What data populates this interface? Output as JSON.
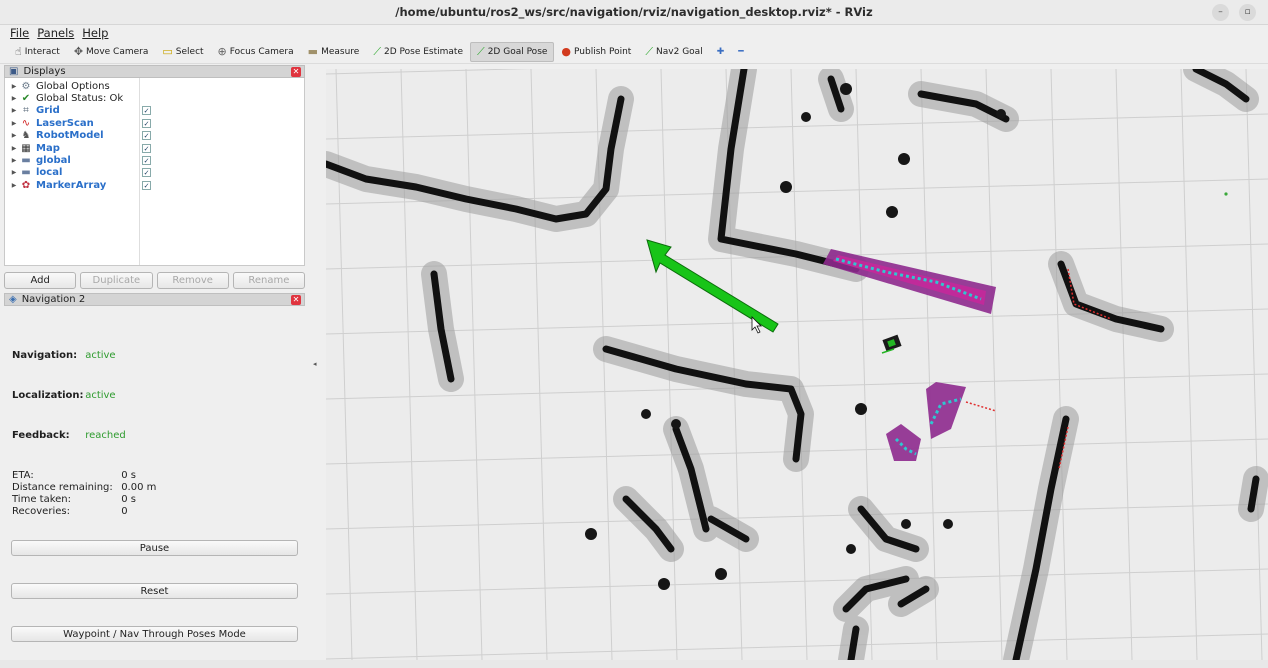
{
  "window": {
    "title": "/home/ubuntu/ros2_ws/src/navigation/rviz/navigation_desktop.rviz* - RViz",
    "minimize_glyph": "–",
    "restore_glyph": "▫"
  },
  "menu": [
    "File",
    "Panels",
    "Help"
  ],
  "toolbar": {
    "tools": [
      {
        "label": "Interact",
        "icon": "hand-icon",
        "glyph": "☝",
        "color": "#444444"
      },
      {
        "label": "Move Camera",
        "icon": "move-icon",
        "glyph": "✥",
        "color": "#555555"
      },
      {
        "label": "Select",
        "icon": "select-icon",
        "glyph": "▭",
        "color": "#c9a400"
      },
      {
        "label": "Focus Camera",
        "icon": "focus-icon",
        "glyph": "⊕",
        "color": "#666666"
      },
      {
        "label": "Measure",
        "icon": "ruler-icon",
        "glyph": "▬",
        "color": "#a0916a"
      },
      {
        "label": "2D Pose Estimate",
        "icon": "pose-arrow-icon",
        "glyph": "⟋",
        "color": "#2eaa2e"
      },
      {
        "label": "2D Goal Pose",
        "icon": "goal-arrow-icon",
        "glyph": "⟋",
        "color": "#2eaa2e",
        "active": true
      },
      {
        "label": "Publish Point",
        "icon": "map-pin-icon",
        "glyph": "●",
        "color": "#d23a1e"
      },
      {
        "label": "Nav2 Goal",
        "icon": "nav2-arrow-icon",
        "glyph": "⟋",
        "color": "#2eaa2e"
      }
    ],
    "add_glyph": "✚",
    "remove_glyph": "━"
  },
  "displays": {
    "title": "Displays",
    "items": [
      {
        "label": "Global Options",
        "icon": "gear-icon",
        "glyph": "⚙",
        "color": "#6a7a8a",
        "checked": null,
        "blue": false
      },
      {
        "label": "Global Status: Ok",
        "icon": "checkmark-icon",
        "glyph": "✔",
        "color": "#2c8a2c",
        "checked": null,
        "blue": false
      },
      {
        "label": "Grid",
        "icon": "grid-icon",
        "glyph": "⌗",
        "color": "#556677",
        "checked": true,
        "blue": true
      },
      {
        "label": "LaserScan",
        "icon": "laser-icon",
        "glyph": "∿",
        "color": "#d02020",
        "checked": true,
        "blue": true
      },
      {
        "label": "RobotModel",
        "icon": "robot-icon",
        "glyph": "♞",
        "color": "#555555",
        "checked": true,
        "blue": true
      },
      {
        "label": "Map",
        "icon": "map-icon",
        "glyph": "▦",
        "color": "#333333",
        "checked": true,
        "blue": true
      },
      {
        "label": "global",
        "icon": "folder-icon",
        "glyph": "▬",
        "color": "#6a7fa0",
        "checked": true,
        "blue": true
      },
      {
        "label": "local",
        "icon": "folder-icon",
        "glyph": "▬",
        "color": "#6a7fa0",
        "checked": true,
        "blue": true
      },
      {
        "label": "MarkerArray",
        "icon": "marker-icon",
        "glyph": "✿",
        "color": "#c03040",
        "checked": true,
        "blue": true
      }
    ],
    "check_glyph": "✓",
    "close_glyph": "✕",
    "buttons": [
      {
        "label": "Add",
        "enabled": true
      },
      {
        "label": "Duplicate",
        "enabled": false
      },
      {
        "label": "Remove",
        "enabled": false
      },
      {
        "label": "Rename",
        "enabled": false
      }
    ]
  },
  "navigation": {
    "title": "Navigation 2",
    "status": [
      {
        "key": "Navigation:",
        "value": "active"
      },
      {
        "key": "Localization:",
        "value": "active"
      },
      {
        "key": "Feedback:",
        "value": "reached"
      }
    ],
    "stats": [
      {
        "key": "ETA:",
        "value": "0 s"
      },
      {
        "key": "Distance remaining:",
        "value": "0.00 m"
      },
      {
        "key": "Time taken:",
        "value": "0 s"
      },
      {
        "key": "Recoveries:",
        "value": "0"
      }
    ],
    "buttons": [
      "Pause",
      "Reset",
      "Waypoint / Nav Through Poses Mode"
    ]
  },
  "colors": {
    "goal_arrow": "#18c418",
    "costmap": "#8e2a8e",
    "inflation": "#c02a9a",
    "laser": "#e03030",
    "footprint": "#2fc7d0"
  }
}
